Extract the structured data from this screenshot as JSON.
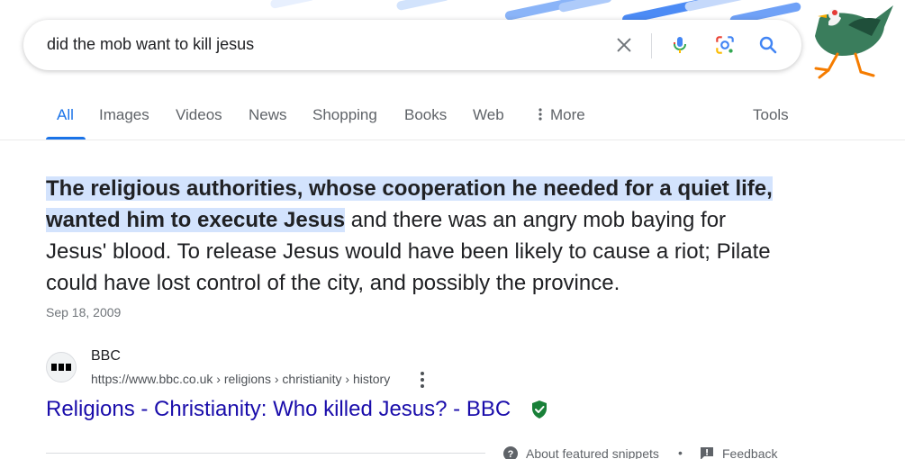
{
  "search": {
    "query": "did the mob want to kill jesus",
    "icons": [
      "close-icon",
      "microphone-icon",
      "lens-camera-icon",
      "search-icon"
    ]
  },
  "tabs": [
    {
      "label": "All",
      "active": true
    },
    {
      "label": "Images"
    },
    {
      "label": "Videos"
    },
    {
      "label": "News"
    },
    {
      "label": "Shopping"
    },
    {
      "label": "Books"
    },
    {
      "label": "Web"
    },
    {
      "label": "More",
      "icon": "vertical-dots-icon"
    },
    {
      "label": "Tools"
    }
  ],
  "snippet": {
    "highlighted": "The religious authorities, whose cooperation he needed for a quiet life, wanted him to execute Jesus",
    "rest": " and there was an angry mob baying for Jesus' blood. To release Jesus would have been likely to cause a riot; Pilate could have lost control of the city, and possibly the province.",
    "date": "Sep 18, 2009"
  },
  "source": {
    "name": "BBC",
    "url": "https://www.bbc.co.uk › religions › christianity › history",
    "title": "Religions - Christianity: Who killed Jesus? - BBC"
  },
  "footer": {
    "about": "About featured snippets",
    "separator": "•",
    "feedback": "Feedback"
  },
  "colors": {
    "accent": "#1a73e8",
    "link": "#1a0dab",
    "highlight": "#d3e3fd",
    "verified": "#188038"
  }
}
